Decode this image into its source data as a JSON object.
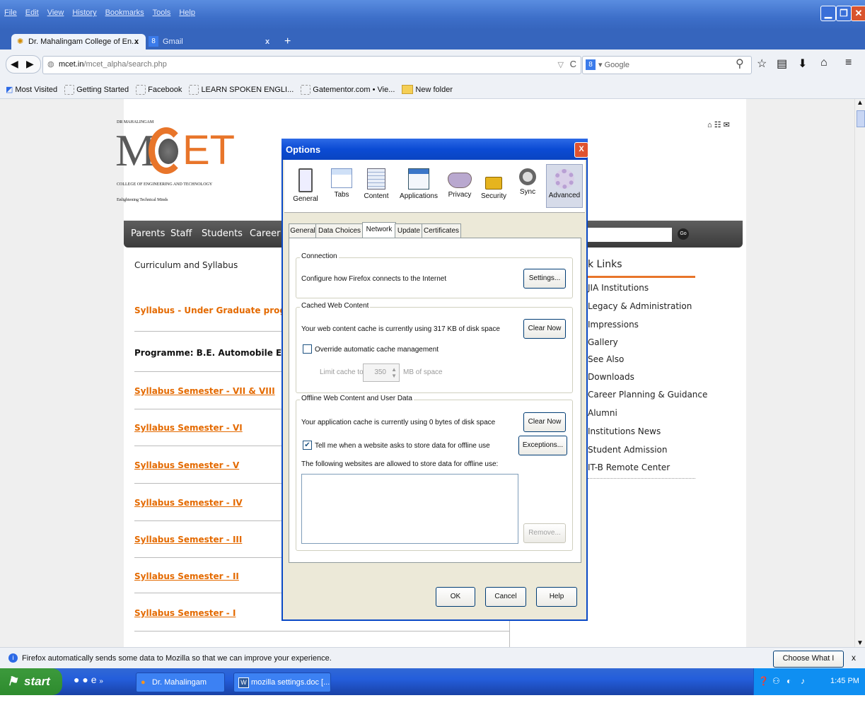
{
  "browser": {
    "menu": [
      "File",
      "Edit",
      "View",
      "History",
      "Bookmarks",
      "Tools",
      "Help"
    ],
    "tabs": [
      {
        "label": "Dr. Mahalingam College of En...",
        "close": "x"
      },
      {
        "label": "Gmail",
        "close": "x"
      }
    ],
    "new_tab": "+",
    "url_host": "mcet.in",
    "url_path": "/mcet_alpha/search.php",
    "search_placeholder": "Google",
    "bookmarks": [
      "Most Visited",
      "Getting Started",
      "Facebook",
      "LEARN SPOKEN ENGLI...",
      "Gatementor.com • Vie...",
      "New folder"
    ]
  },
  "site": {
    "logo_top": "DR MAHALINGAM",
    "logo_letters": "M",
    "logo_tail": "ET",
    "logo_sub": "COLLEGE OF ENGINEERING AND TECHNOLOGY",
    "logo_tag": "Enlightening Technical Minds",
    "nav": [
      "Parents",
      "Staff",
      "Students",
      "Career"
    ],
    "go": "Go",
    "breadcrumb": "Curriculum and Syllabus",
    "heading": "Syllabus - Under Graduate progr",
    "programme": "Programme: B.E. Automobile Engi",
    "semesters": [
      "Syllabus Semester - VII & VIII",
      "Syllabus Semester - VI",
      "Syllabus Semester - V",
      "Syllabus Semester - IV",
      "Syllabus Semester - III",
      "Syllabus Semester - II",
      "Syllabus Semester - I"
    ],
    "quick_title": "k Links",
    "quick_links": [
      "JIA Institutions",
      "Legacy & Administration",
      "Impressions",
      "Gallery",
      "See Also",
      "Downloads",
      "Career Planning & Guidance",
      "Alumni",
      "Institutions News",
      "Student Admission",
      "IT-B Remote Center"
    ]
  },
  "dialog": {
    "title": "Options",
    "close": "X",
    "toolbar": [
      "General",
      "Tabs",
      "Content",
      "Applications",
      "Privacy",
      "Security",
      "Sync",
      "Advanced"
    ],
    "subtabs": [
      "General",
      "Data Choices",
      "Network",
      "Update",
      "Certificates"
    ],
    "connection": {
      "label": "Connection",
      "text": "Configure how Firefox connects to the Internet",
      "button": "Settings..."
    },
    "cache": {
      "label": "Cached Web Content",
      "text": "Your web content cache is currently using 317 KB of disk space",
      "button": "Clear Now",
      "override": "Override automatic cache management",
      "limit_label": "Limit cache to",
      "limit_value": "350",
      "limit_unit": "MB of space"
    },
    "offline": {
      "label": "Offline Web Content and User Data",
      "text": "Your application cache is currently using 0 bytes of disk space",
      "button": "Clear Now",
      "tell": "Tell me when a website asks to store data for offline use",
      "exceptions": "Exceptions...",
      "allowed": "The following websites are allowed to store data for offline use:",
      "remove": "Remove..."
    },
    "ok": "OK",
    "cancel": "Cancel",
    "help": "Help"
  },
  "notification": {
    "text": "Firefox automatically sends some data to Mozilla so that we can improve your experience.",
    "button": "Choose What I Share",
    "close": "x"
  },
  "taskbar": {
    "start": "start",
    "tasks": [
      "Dr. Mahalingam Colle...",
      "mozilla settings.doc [..."
    ],
    "time": "1:45 PM"
  }
}
